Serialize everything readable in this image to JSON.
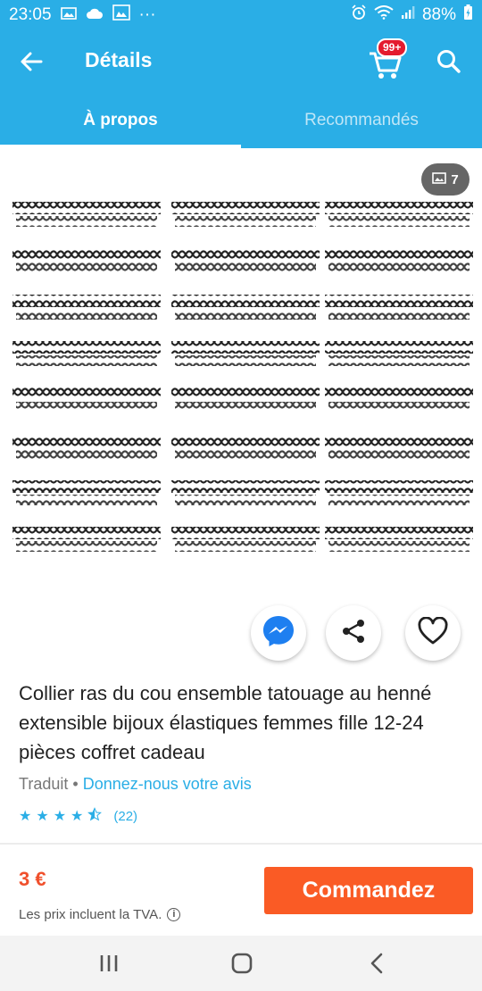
{
  "status_bar": {
    "time": "23:05",
    "battery": "88%",
    "more": "···",
    "icons": [
      "image-icon",
      "cloud-icon",
      "gallery-icon",
      "alarm-icon",
      "wifi-icon",
      "signal-icon",
      "battery-icon"
    ]
  },
  "header": {
    "title": "Détails",
    "cart_badge": "99+",
    "color": "#2aaee6"
  },
  "tabs": [
    {
      "label": "À propos",
      "active": true
    },
    {
      "label": "Recommandés",
      "active": false
    }
  ],
  "gallery": {
    "photo_count": "7"
  },
  "actions": [
    "messenger-icon",
    "share-icon",
    "heart-icon"
  ],
  "product": {
    "title": "Collier ras du cou ensemble tatouage au henné extensible bijoux élastiques femmes fille 12-24 pièces coffret cadeau",
    "translated": "Traduit",
    "separator": "•",
    "feedback_link": "Donnez-nous votre avis",
    "rating": 4.5,
    "rating_count": "(22)"
  },
  "purchase": {
    "price": "3 €",
    "vat_note": "Les prix incluent la TVA.",
    "info": "i",
    "order_label": "Commandez",
    "order_color": "#fa5b25"
  },
  "nav": [
    "recent-apps-icon",
    "home-icon",
    "back-icon"
  ]
}
